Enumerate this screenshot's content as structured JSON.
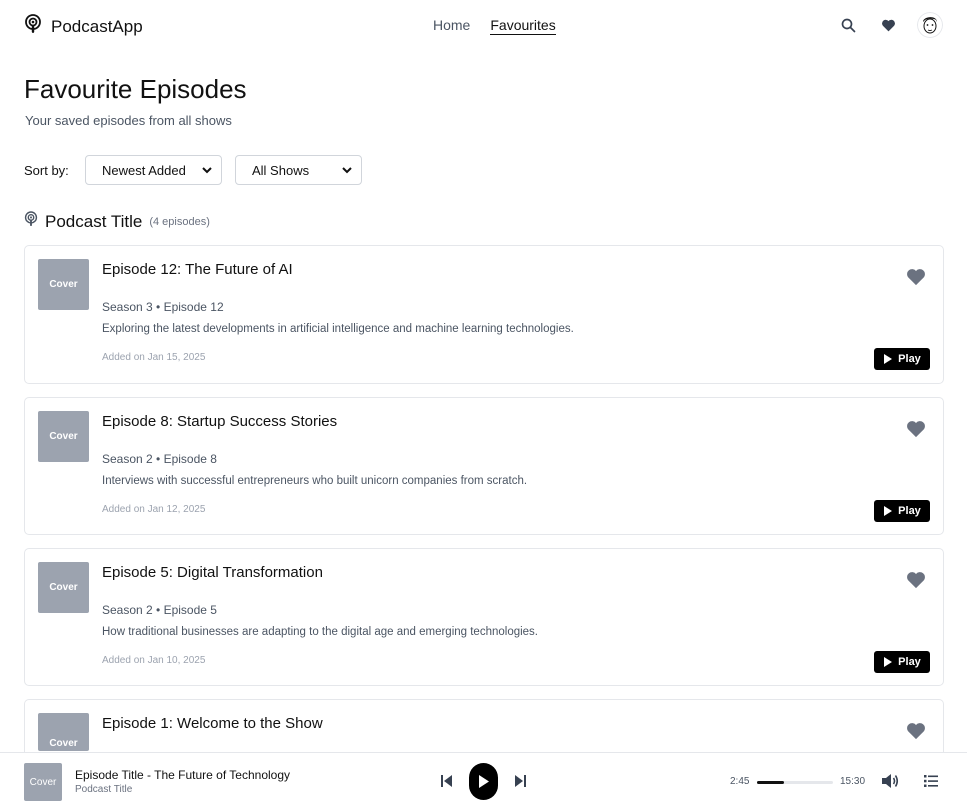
{
  "header": {
    "brand": "PodcastApp",
    "nav": [
      "Home",
      "Favourites"
    ],
    "active_nav": "Favourites"
  },
  "page": {
    "title": "Favourite Episodes",
    "subtitle": "Your saved episodes from all shows"
  },
  "filters": {
    "sort_label": "Sort by:",
    "sort_value": "Newest Added",
    "show_value": "All Shows"
  },
  "section": {
    "title": "Podcast Title",
    "count": "(4 episodes)"
  },
  "episodes": [
    {
      "cover": "Cover",
      "title": "Episode 12: The Future of AI",
      "meta": "Season 3 • Episode 12",
      "description": "Exploring the latest developments in artificial intelligence and machine learning technologies.",
      "added": "Added on Jan 15, 2025",
      "play": "Play"
    },
    {
      "cover": "Cover",
      "title": "Episode 8: Startup Success Stories",
      "meta": "Season 2 • Episode 8",
      "description": "Interviews with successful entrepreneurs who built unicorn companies from scratch.",
      "added": "Added on Jan 12, 2025",
      "play": "Play"
    },
    {
      "cover": "Cover",
      "title": "Episode 5: Digital Transformation",
      "meta": "Season 2 • Episode 5",
      "description": "How traditional businesses are adapting to the digital age and emerging technologies.",
      "added": "Added on Jan 10, 2025",
      "play": "Play"
    },
    {
      "cover": "Cover",
      "title": "Episode 1: Welcome to the Show",
      "meta": "",
      "description": "",
      "added": "",
      "play": ""
    }
  ],
  "player": {
    "cover": "Cover",
    "title": "Episode Title - The Future of Technology",
    "subtitle": "Podcast Title",
    "current_time": "2:45",
    "total_time": "15:30",
    "progress_fraction": 0.35
  },
  "colors": {
    "accent": "#000000",
    "cover_bg": "#9ca3af",
    "heart": "#6b7280",
    "border": "#e5e7eb"
  },
  "icons": {
    "brand": "podcast-icon",
    "search": "search-icon",
    "favourites": "heart-icon",
    "avatar": "avatar",
    "play": "play-icon",
    "prev": "skip-back-icon",
    "next": "skip-forward-icon",
    "volume": "volume-icon",
    "queue": "queue-list-icon"
  }
}
